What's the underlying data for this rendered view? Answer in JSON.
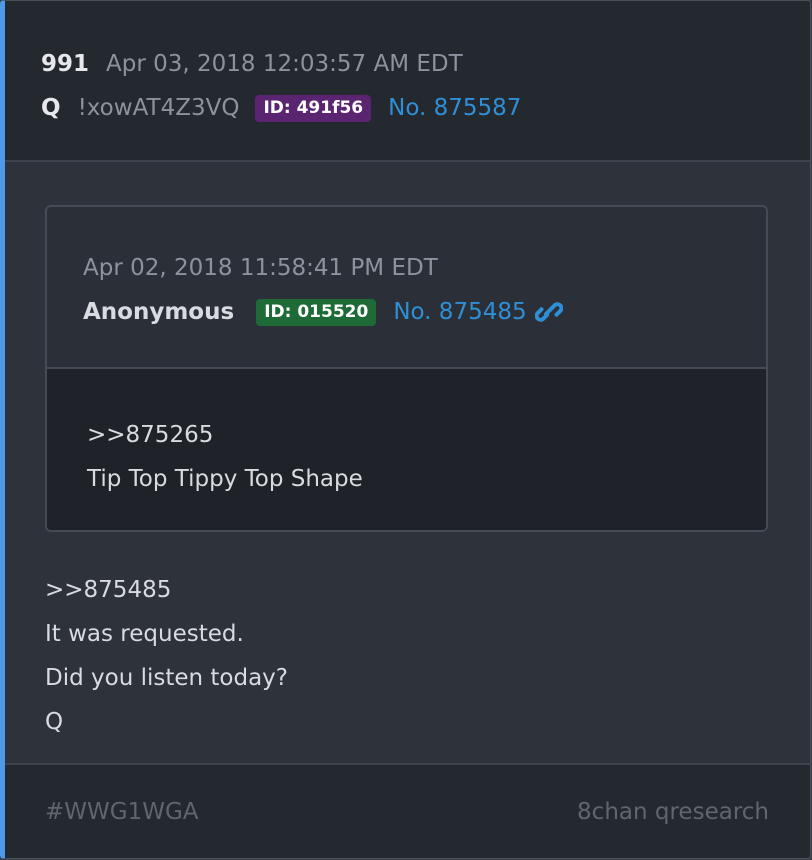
{
  "post": {
    "number": "991",
    "date": "Apr 03, 2018 12:03:57 AM EDT",
    "author": "Q",
    "tripcode": "!xowAT4Z3VQ",
    "id_badge": "ID: 491f56",
    "post_no": "No. 875587"
  },
  "quoted": {
    "date": "Apr 02, 2018 11:58:41 PM EDT",
    "author": "Anonymous",
    "id_badge": "ID: 015520",
    "post_no": "No. 875485",
    "icon": "link-icon",
    "lines": [
      ">>875265",
      "Tip Top Tippy Top Shape"
    ]
  },
  "message": {
    "lines": [
      ">>875485",
      "It was requested.",
      "Did you listen today?",
      "Q"
    ]
  },
  "footer": {
    "tag": "#WWG1WGA",
    "source": "8chan qresearch"
  },
  "colors": {
    "accent_left_border": "#4f9ae8",
    "id_badge_q": "#5b2470",
    "id_badge_anon": "#1e6b38",
    "link": "#2f8fd6"
  }
}
